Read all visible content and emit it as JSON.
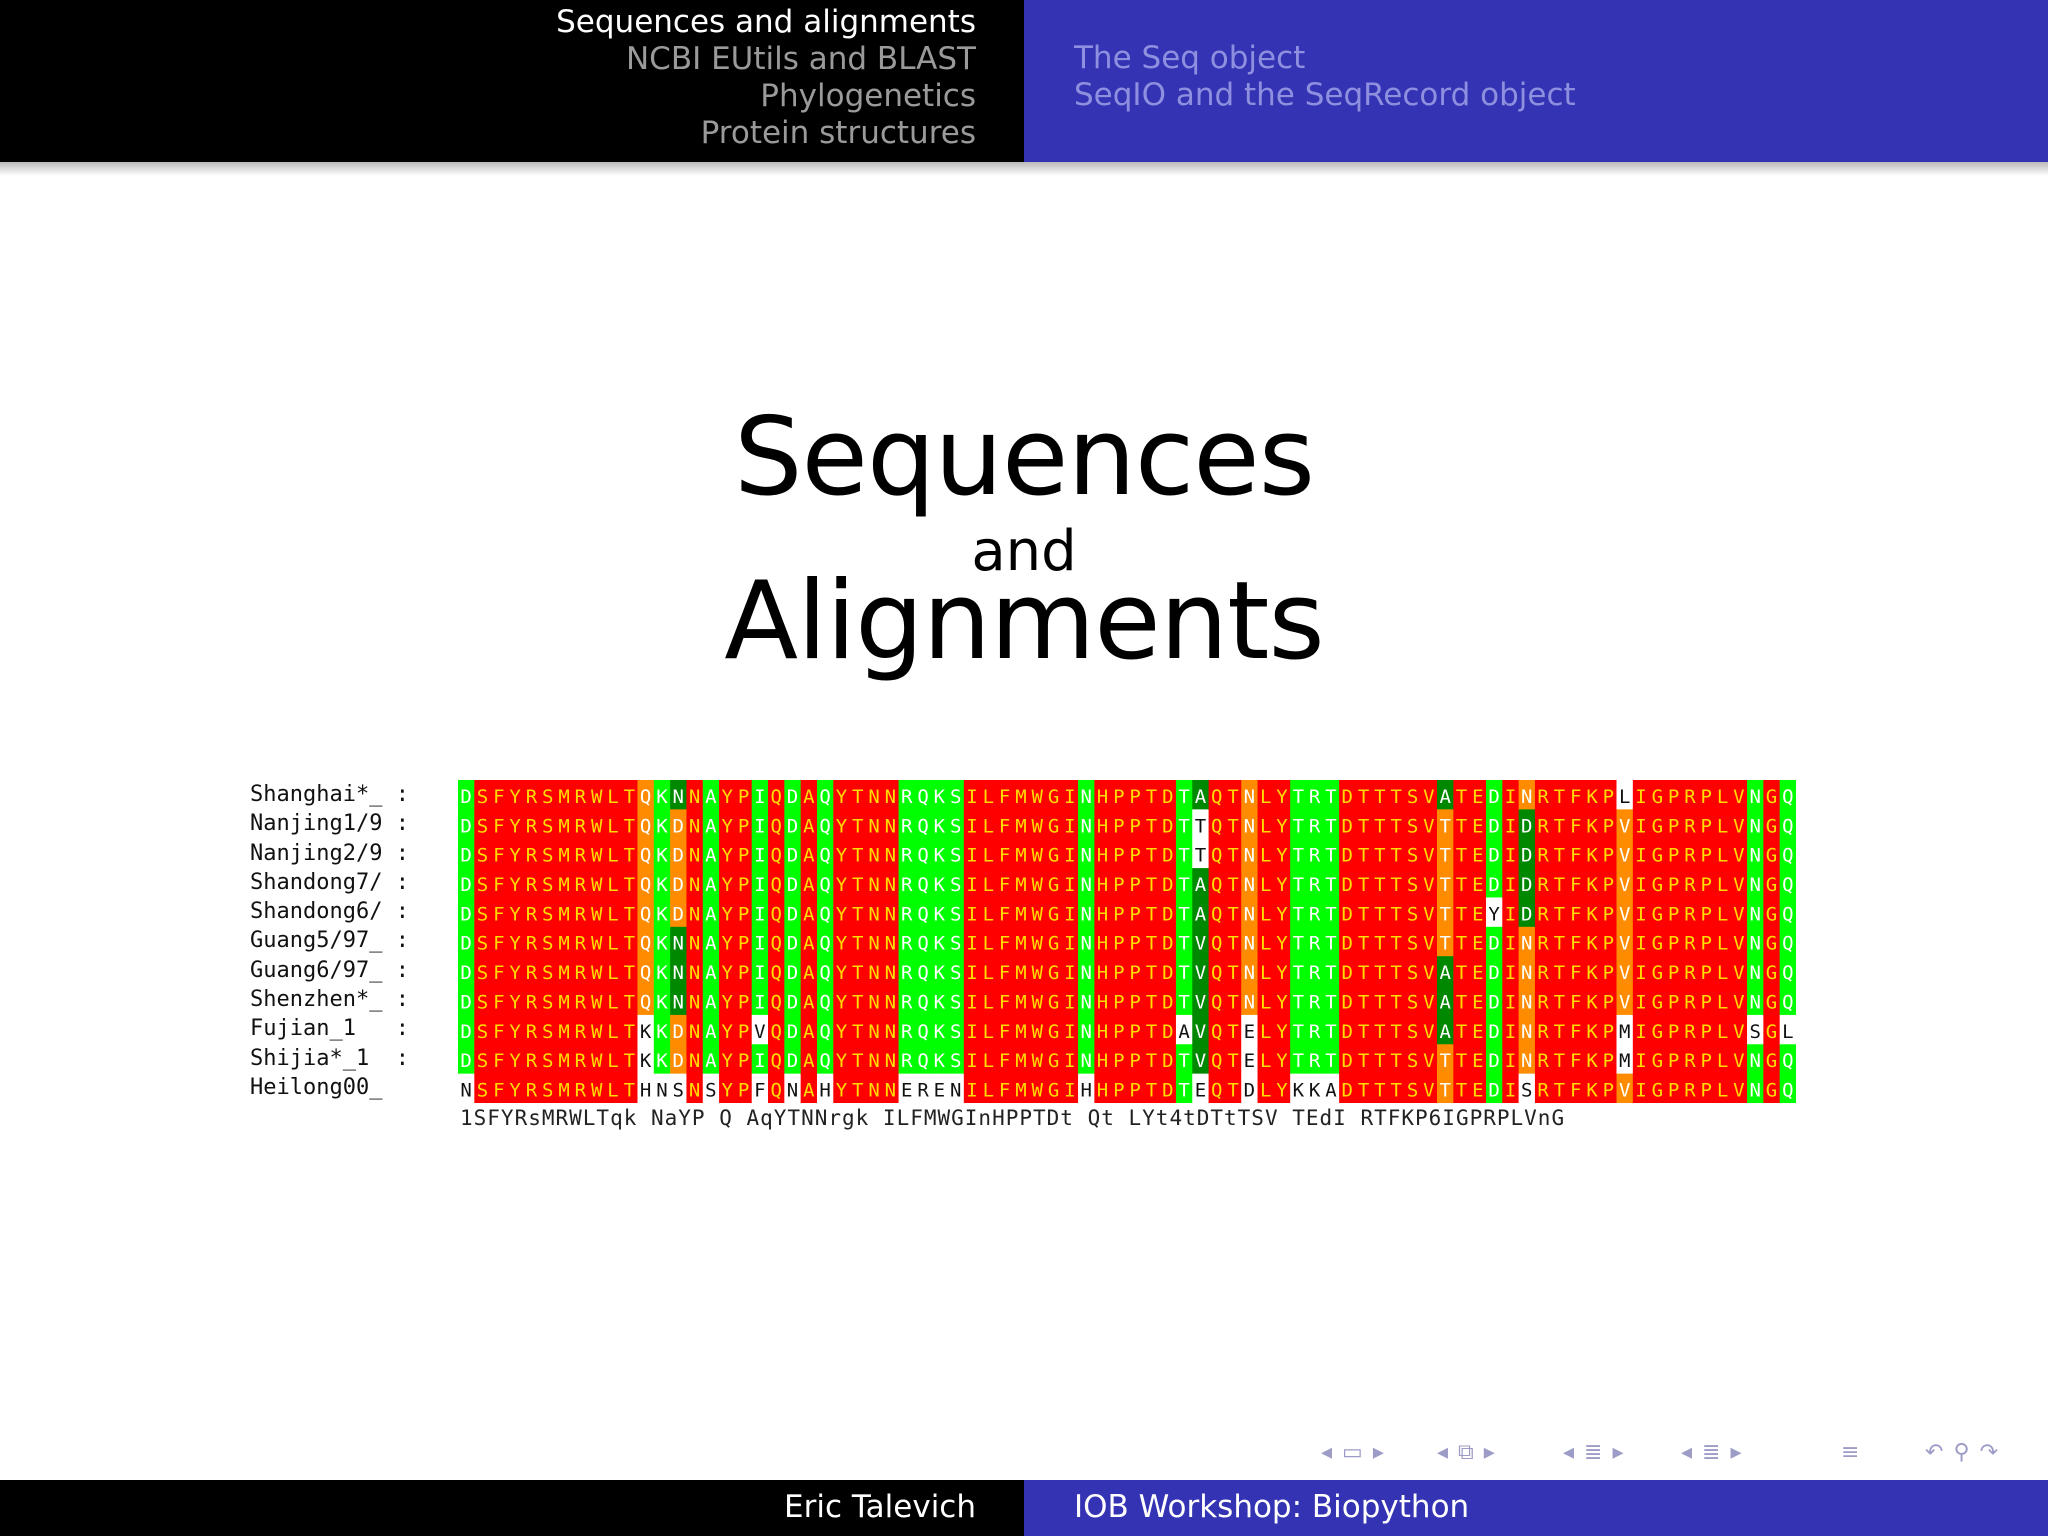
{
  "header": {
    "sections": [
      {
        "label": "Sequences and alignments",
        "active": true
      },
      {
        "label": "NCBI EUtils and BLAST",
        "active": false
      },
      {
        "label": "Phylogenetics",
        "active": false
      },
      {
        "label": "Protein structures",
        "active": false
      }
    ],
    "subsections": [
      {
        "label": "The Seq object"
      },
      {
        "label": "SeqIO and the SeqRecord object"
      }
    ],
    "left_color": "#000000",
    "right_color": "#3333b3"
  },
  "title": {
    "line1": "Sequences",
    "line2": "and",
    "line3": "Alignments"
  },
  "alignment": {
    "names": [
      "Shanghai*_ :",
      "Nanjing1/9 :",
      "Nanjing2/9 :",
      "Shandong7/ :",
      "Shandong6/ :",
      "Guang5/97_ :",
      "Guang6/97_ :",
      "Shenzhen*_ :",
      "Fujian_1   :",
      "Shijia*_1  :",
      "Heilong00_ "
    ],
    "sequences": [
      "DSFYRSMRWLTQKNNAYPIQDAQYTNNRQKSILFMWGINHPPTDTAQTNLYTRTDTTTSVATEDINRTFKPLIGPRPLVNGQ",
      "DSFYRSMRWLTQKDNAYPIQDAQYTNNRQKSILFMWGINHPPTDTTQTNLYTRTDTTTSVTTEDIDRTFKPVIGPRPLVNGQ",
      "DSFYRSMRWLTQKDNAYPIQDAQYTNNRQKSILFMWGINHPPTDTTQTNLYTRTDTTTSVTTEDIDRTFKPVIGPRPLVNGQ",
      "DSFYRSMRWLTQKDNAYPIQDAQYTNNRQKSILFMWGINHPPTDTAQTNLYTRTDTTTSVTTEDIDRTFKPVIGPRPLVNGQ",
      "DSFYRSMRWLTQKDNAYPIQDAQYTNNRQKSILFMWGINHPPTDTAQTNLYTRTDTTTSVTTEYIDRTFKPVIGPRPLVNGQ",
      "DSFYRSMRWLTQKNNAYPIQDAQYTNNRQKSILFMWGINHPPTDTVQTNLYTRTDTTTSVTTEDINRTFKPVIGPRPLVNGQ",
      "DSFYRSMRWLTQKNNAYPIQDAQYTNNRQKSILFMWGINHPPTDTVQTNLYTRTDTTTSVATEDINRTFKPVIGPRPLVNGQ",
      "DSFYRSMRWLTQKNNAYPIQDAQYTNNRQKSILFMWGINHPPTDTVQTNLYTRTDTTTSVATEDINRTFKPVIGPRPLVNGQ",
      "DSFYRSMRWLTKKDNAYPVQDAQYTNNRQKSILFMWGINHPPTDAVQTELYTRTDTTTSVATEDINRTFKPMIGPRPLVSGL",
      "DSFYRSMRWLTKKDNAYPIQDAQYTNNRQKSILFMWGINHPPTDTVQTELYTRTDTTTSVTTEDINRTFKPMIGPRPLVNGQ",
      "NSFYRSMRWLTHNSNSYPFQNAHYTNNERENILFMWGIHHPPTDTEQTDLYKKADTTTSVTTEDISRTFKPVIGPRPLVNGQ"
    ],
    "consensus": "1SFYRsMRWLTqk NaYP Q AqYTNNrgk ILFMWGInHPPTDt Qt LYt4tDTtTSV TEdI RTFKP6IGPRPLVnG",
    "colors": {
      "red": "#ff0000",
      "green": "#00ff00",
      "dark_green": "#008800",
      "orange": "#ff8c00",
      "white": "#ffffff"
    }
  },
  "nav_icons": [
    "arrow-left-icon",
    "frame-icon",
    "arrow-right-icon",
    "arrow-left-icon",
    "subsection-icon",
    "arrow-right-icon",
    "arrow-left-icon",
    "section-icon",
    "arrow-right-icon",
    "arrow-left-icon",
    "doc-icon",
    "arrow-right-icon",
    "align-icon",
    "undo-icon",
    "search-icon",
    "redo-icon"
  ],
  "footer": {
    "author": "Eric Talevich",
    "event": "IOB Workshop: Biopython"
  }
}
